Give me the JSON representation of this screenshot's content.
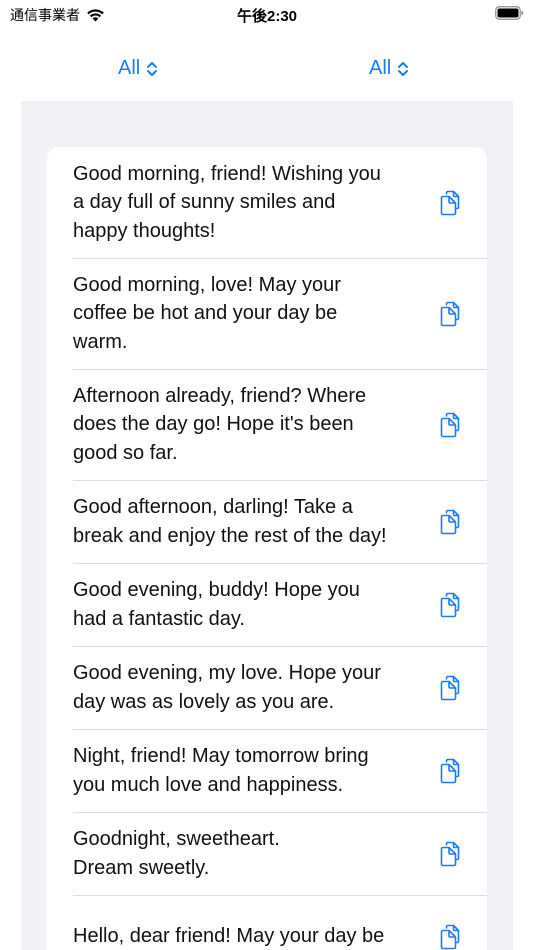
{
  "status_bar": {
    "carrier": "通信事業者",
    "time": "午後2:30"
  },
  "filters": {
    "left_label": "All",
    "right_label": "All"
  },
  "accent_color": "#1a7cf5",
  "messages": [
    {
      "text": "Good morning, friend! Wishing you\na day full of sunny smiles and\nhappy thoughts!"
    },
    {
      "text": "Good morning, love! May your\ncoffee be hot and your day be\nwarm."
    },
    {
      "text": "Afternoon already, friend? Where\ndoes the day go! Hope it's been\ngood so far."
    },
    {
      "text": "Good afternoon, darling! Take a\nbreak and enjoy the rest of the day!"
    },
    {
      "text": "Good evening, buddy! Hope you\nhad a fantastic day."
    },
    {
      "text": "Good evening, my love. Hope your\nday was as lovely as you are."
    },
    {
      "text": "Night, friend! May tomorrow bring\nyou much love and happiness."
    },
    {
      "text": "Goodnight, sweetheart.\nDream sweetly."
    },
    {
      "text": "Hello, dear friend! May your day be"
    }
  ]
}
